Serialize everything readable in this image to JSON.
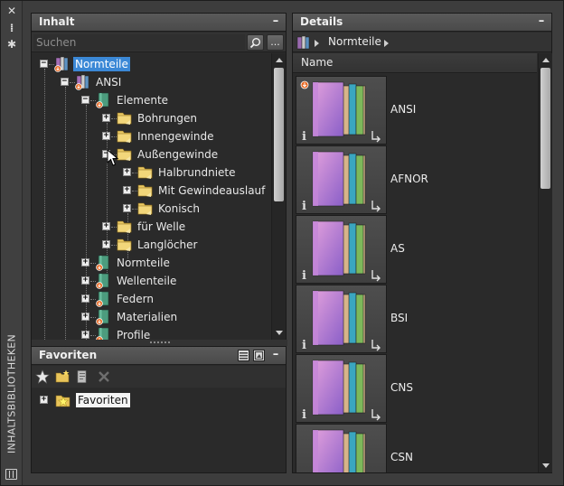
{
  "strip": {
    "title": "INHALTSBIBLIOTHEKEN",
    "close_label": "✕",
    "pin_label": "⁞",
    "settings_label": "✱"
  },
  "inhalt": {
    "title": "Inhalt",
    "minimize_label": "–",
    "search_placeholder": "Suchen",
    "search_button_icon": "magnifier-icon",
    "more_label": "...",
    "tree": [
      {
        "label": "Normteile",
        "level": 0,
        "expander": "−",
        "icon": "library-icon",
        "selected": true
      },
      {
        "label": "ANSI",
        "level": 1,
        "expander": "−",
        "icon": "library-icon",
        "selected": false
      },
      {
        "label": "Elemente",
        "level": 2,
        "expander": "−",
        "icon": "green-book-icon",
        "selected": false
      },
      {
        "label": "Bohrungen",
        "level": 3,
        "expander": "+",
        "icon": "folder-icon",
        "selected": false
      },
      {
        "label": "Innengewinde",
        "level": 3,
        "expander": "+",
        "icon": "folder-icon",
        "selected": false
      },
      {
        "label": "Außengewinde",
        "level": 3,
        "expander": "−",
        "icon": "folder-icon",
        "selected": false
      },
      {
        "label": "Halbrundniete",
        "level": 4,
        "expander": "+",
        "icon": "folder-icon",
        "selected": false
      },
      {
        "label": "Mit Gewindeauslauf",
        "level": 4,
        "expander": "+",
        "icon": "folder-icon",
        "selected": false
      },
      {
        "label": "Konisch",
        "level": 4,
        "expander": "+",
        "icon": "folder-icon",
        "selected": false
      },
      {
        "label": "für Welle",
        "level": 3,
        "expander": "+",
        "icon": "folder-icon",
        "selected": false
      },
      {
        "label": "Langlöcher",
        "level": 3,
        "expander": "+",
        "icon": "folder-icon",
        "selected": false
      },
      {
        "label": "Normteile",
        "level": 2,
        "expander": "+",
        "icon": "green-book-icon",
        "selected": false
      },
      {
        "label": "Wellenteile",
        "level": 2,
        "expander": "+",
        "icon": "green-book-icon",
        "selected": false
      },
      {
        "label": "Federn",
        "level": 2,
        "expander": "+",
        "icon": "green-book-icon",
        "selected": false
      },
      {
        "label": "Materialien",
        "level": 2,
        "expander": "+",
        "icon": "green-book-icon",
        "selected": false
      },
      {
        "label": "Profile",
        "level": 2,
        "expander": "+",
        "icon": "green-book-icon",
        "selected": false
      }
    ]
  },
  "favoriten": {
    "title": "Favoriten",
    "minimize_label": "–",
    "tree": [
      {
        "label": "Favoriten",
        "expander": "+",
        "icon": "star-folder-icon"
      }
    ]
  },
  "details": {
    "title": "Details",
    "minimize_label": "–",
    "breadcrumb": "Normteile",
    "column_header": "Name",
    "items": [
      {
        "name": "ANSI"
      },
      {
        "name": "AFNOR"
      },
      {
        "name": "AS"
      },
      {
        "name": "BSI"
      },
      {
        "name": "CNS"
      },
      {
        "name": "CSN"
      }
    ]
  },
  "colors": {
    "selection": "#3b88d6",
    "panel_bg": "#2b2b2b",
    "header": "#505050"
  }
}
